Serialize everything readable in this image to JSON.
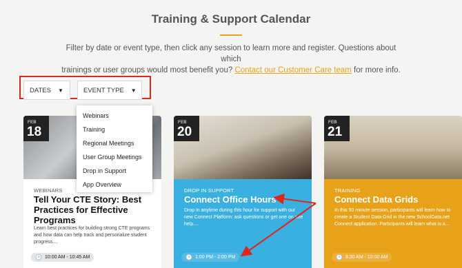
{
  "header": {
    "title": "Training & Support Calendar",
    "intro_line1": "Filter by date or event type, then click any session to learn more and register. Questions about which",
    "intro_line2_pre": "trainings or user groups would most benefit you? ",
    "intro_link": "Contact our Customer Care team",
    "intro_line2_post": " for more info."
  },
  "filters": {
    "dates_label": "DATES",
    "event_type_label": "EVENT TYPE",
    "caret_icon": "caret-down-icon"
  },
  "dropdown": {
    "items": [
      "Webinars",
      "Training",
      "Regional Meetings",
      "User Group Meetings",
      "Drop in Support",
      "App Overview"
    ]
  },
  "cards": [
    {
      "month": "FEB",
      "day": "18",
      "category": "WEBINARS",
      "title": "Tell Your CTE Story: Best Practices for Effective Programs",
      "description": "Learn best practices for building strong CTE programs and how data can help track and personalize student progress....",
      "time": "10:00 AM - 10:45 AM"
    },
    {
      "month": "FEB",
      "day": "20",
      "category": "DROP IN SUPPORT",
      "title": "Connect Office Hours",
      "description": "Drop in anytime during this hour for support with our new Connect Platform: ask questions or get one on one help....",
      "time": "1:00 PM - 2:00 PM"
    },
    {
      "month": "FEB",
      "day": "21",
      "category": "TRAINING",
      "title": "Connect Data Grids",
      "description": "In this 90 minute session, participants will learn how to create a Student Data Grid in the new SchoolData.net Connect application. Participants will learn what is a...",
      "time": "8:30 AM - 10:00 AM"
    }
  ],
  "colors": {
    "accent_orange": "#e8a21a",
    "card_blue": "#3ab0e0",
    "highlight_red": "#e0251b"
  }
}
